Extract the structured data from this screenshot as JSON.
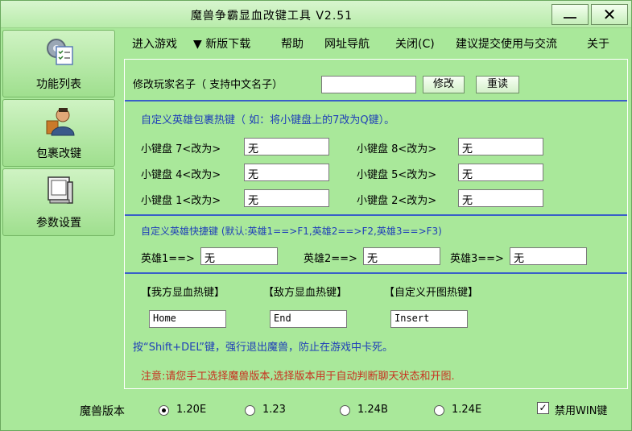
{
  "window": {
    "title": "魔兽争霸显血改键工具 V2.51",
    "min_glyph": "—",
    "close_glyph": "✕"
  },
  "sidebar": {
    "items": [
      {
        "label": "功能列表",
        "icon": "checklist-gear-icon"
      },
      {
        "label": "包裹改键",
        "icon": "user-icon"
      },
      {
        "label": "参数设置",
        "icon": "computer-icon"
      }
    ]
  },
  "menu": {
    "items": [
      "进入游戏",
      "▼ 新版下载",
      "帮助",
      "网址导航",
      "关闭(C)",
      "建议提交使用与交流",
      "关于"
    ]
  },
  "rename": {
    "label": "修改玩家名子（ 支持中文名子）",
    "value": "",
    "modify_btn": "修改",
    "reread_btn": "重读"
  },
  "bag": {
    "heading": "自定义英雄包裹热键（ 如：将小键盘上的7改为Q键）。",
    "rows": [
      {
        "label": "小键盘 7<改为>",
        "value": "无"
      },
      {
        "label": "小键盘 8<改为>",
        "value": "无"
      },
      {
        "label": "小键盘 4<改为>",
        "value": "无"
      },
      {
        "label": "小键盘 5<改为>",
        "value": "无"
      },
      {
        "label": "小键盘 1<改为>",
        "value": "无"
      },
      {
        "label": "小键盘 2<改为>",
        "value": "无"
      }
    ]
  },
  "heroes": {
    "heading": "自定义英雄快捷键 (默认:英雄1==>F1,英雄2==>F2,英雄3==>F3)",
    "rows": [
      {
        "label": "英雄1==>",
        "value": "无"
      },
      {
        "label": "英雄2==>",
        "value": "无"
      },
      {
        "label": "英雄3==>",
        "value": "无"
      }
    ]
  },
  "hotkeys": {
    "labels": [
      "【我方显血热键】",
      "【敌方显血热键】",
      "【自定义开图热键】"
    ],
    "values": [
      "Home",
      "End",
      "Insert"
    ],
    "exit_note": "按“Shift+DEL”键，强行退出魔兽，防止在游戏中卡死。",
    "warning": "注意:请您手工选择魔兽版本,选择版本用于自动判断聊天状态和开图."
  },
  "version": {
    "label": "魔兽版本",
    "options": [
      "1.20E",
      "1.23",
      "1.24B",
      "1.24E"
    ],
    "selected": "1.20E",
    "disable_win_label": "禁用WIN键",
    "disable_win_checked": true
  }
}
